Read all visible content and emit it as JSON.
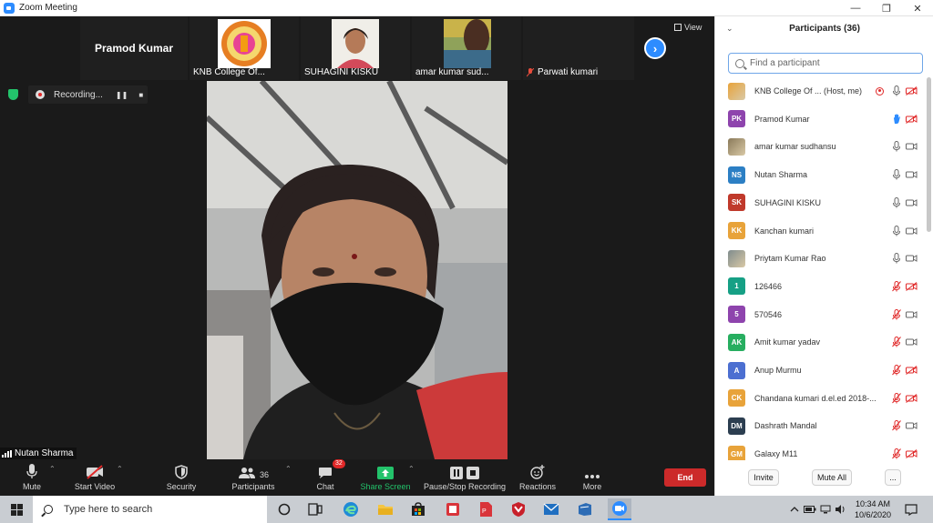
{
  "window": {
    "title": "Zoom Meeting",
    "minimize": "—",
    "maximize": "❐",
    "close": "✕"
  },
  "strip": {
    "pinned_name": "Pramod Kumar",
    "thumbnails": [
      {
        "name": "KNB College Of..."
      },
      {
        "name": "SUHAGINI KISKU"
      },
      {
        "name": "amar kumar sud..."
      },
      {
        "name": "Parwati kumari"
      }
    ],
    "next_arrow": "›",
    "view_label": "View"
  },
  "recording": {
    "label": "Recording...",
    "pause": "❚❚",
    "stop": "■"
  },
  "active_speaker": {
    "name": "Nutan Sharma"
  },
  "toolbar": {
    "mute": "Mute",
    "start_video": "Start Video",
    "security": "Security",
    "participants": "Participants",
    "participants_count": "36",
    "chat": "Chat",
    "chat_badge": "32",
    "share_screen": "Share Screen",
    "pause_recording": "Pause/Stop Recording",
    "reactions": "Reactions",
    "more": "More",
    "end": "End"
  },
  "panel": {
    "title": "Participants (36)",
    "search_placeholder": "Find a participant",
    "participants": [
      {
        "name": "KNB College Of ...  (Host, me)",
        "initials": "",
        "color": "#e8a33a",
        "mic": "on",
        "cam": "off",
        "recording": true
      },
      {
        "name": "Pramod Kumar",
        "initials": "PK",
        "color": "#8e44ad",
        "mic": "hand",
        "cam": "off"
      },
      {
        "name": "amar kumar sudhansu",
        "initials": "",
        "color": "#8a7a5a",
        "mic": "on",
        "cam": "on"
      },
      {
        "name": "Nutan Sharma",
        "initials": "NS",
        "color": "#2c7fc4",
        "mic": "on",
        "cam": "on"
      },
      {
        "name": "SUHAGINI KISKU",
        "initials": "SK",
        "color": "#c0392b",
        "mic": "on",
        "cam": "on"
      },
      {
        "name": "Kanchan kumari",
        "initials": "KK",
        "color": "#e8a33a",
        "mic": "on",
        "cam": "on"
      },
      {
        "name": "Priytam Kumar Rao",
        "initials": "",
        "color": "#7f8c8d",
        "mic": "on",
        "cam": "on"
      },
      {
        "name": "126466",
        "initials": "1",
        "color": "#16a085",
        "mic": "off",
        "cam": "off"
      },
      {
        "name": "570546",
        "initials": "5",
        "color": "#8e44ad",
        "mic": "off",
        "cam": "on"
      },
      {
        "name": "Amit kumar yadav",
        "initials": "AK",
        "color": "#27ae60",
        "mic": "off",
        "cam": "on"
      },
      {
        "name": "Anup Murmu",
        "initials": "A",
        "color": "#4c6fd1",
        "mic": "off",
        "cam": "off"
      },
      {
        "name": "Chandana kumari d.el.ed 2018-...",
        "initials": "CK",
        "color": "#e8a33a",
        "mic": "off",
        "cam": "off"
      },
      {
        "name": "Dashrath Mandal",
        "initials": "DM",
        "color": "#2c3e50",
        "mic": "off",
        "cam": "on"
      },
      {
        "name": "Galaxy M11",
        "initials": "GM",
        "color": "#e8a33a",
        "mic": "off",
        "cam": "off"
      }
    ],
    "invite": "Invite",
    "mute_all": "Mute All",
    "more": "..."
  },
  "taskbar": {
    "search_placeholder": "Type here to search",
    "time": "10:34 AM",
    "date": "10/6/2020"
  },
  "colors": {
    "accent": "#2d8cff",
    "end_red": "#cc2a2a",
    "share_green": "#23c36b"
  }
}
